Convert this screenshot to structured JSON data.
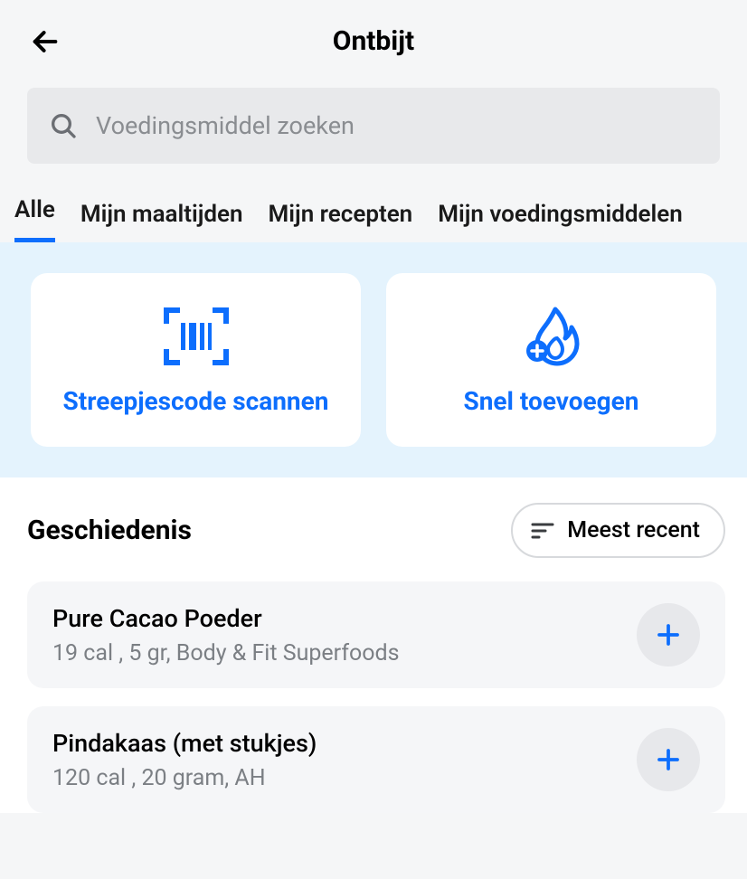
{
  "header": {
    "title": "Ontbijt"
  },
  "search": {
    "placeholder": "Voedingsmiddel zoeken"
  },
  "tabs": [
    {
      "label": "Alle",
      "active": true
    },
    {
      "label": "Mijn maaltijden",
      "active": false
    },
    {
      "label": "Mijn recepten",
      "active": false
    },
    {
      "label": "Mijn voedingsmiddelen",
      "active": false
    }
  ],
  "actions": {
    "scan": "Streepjescode scannen",
    "quick_add": "Snel toevoegen"
  },
  "history": {
    "title": "Geschiedenis",
    "sort_label": "Meest recent",
    "items": [
      {
        "name": "Pure Cacao Poeder",
        "details": "19 cal , 5 gr, Body & Fit Superfoods"
      },
      {
        "name": "Pindakaas (met stukjes)",
        "details": "120 cal , 20 gram, AH"
      }
    ]
  }
}
